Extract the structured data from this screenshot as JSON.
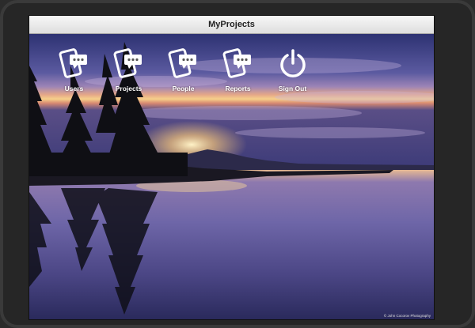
{
  "window": {
    "title": "MyProjects"
  },
  "nav": {
    "items": [
      {
        "label": "Users",
        "icon": "tablet-chat-icon"
      },
      {
        "label": "Projects",
        "icon": "tablet-chat-icon"
      },
      {
        "label": "People",
        "icon": "tablet-chat-icon"
      },
      {
        "label": "Reports",
        "icon": "tablet-chat-icon"
      },
      {
        "label": "Sign Out",
        "icon": "power-icon"
      }
    ]
  },
  "background": {
    "credit": "© John Cocorov Photography"
  },
  "colors": {
    "sky_top": "#2b2f6e",
    "sky_mid": "#7a6aa8",
    "sunset": "#f2c57a",
    "water": "#3a3570",
    "icon": "#ffffff"
  }
}
